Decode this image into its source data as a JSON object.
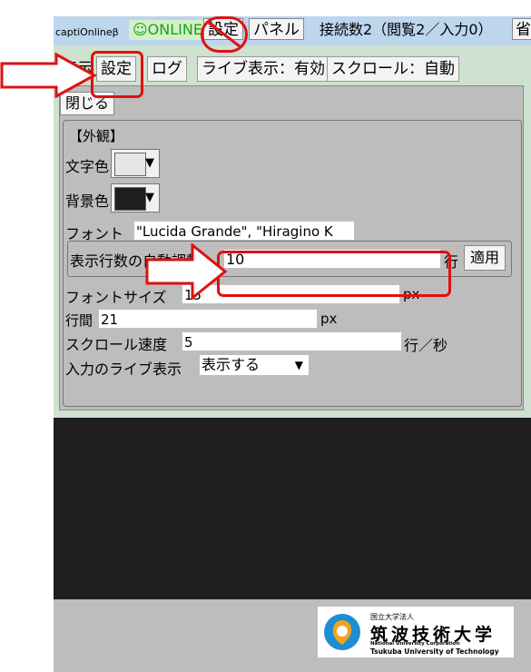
{
  "header": {
    "brand": "captiOnlineβ",
    "online": "☺ONLINE",
    "settings_label": "設定",
    "panel_label": "パネル",
    "connection_status": "接続数2（閲覧2／入力0）",
    "omit_label": "省"
  },
  "tabs": [
    {
      "label": "表示"
    },
    {
      "label": "設定"
    },
    {
      "label": "ログ"
    },
    {
      "label": "ライブ表示：有効"
    },
    {
      "label": "スクロール：自動"
    }
  ],
  "close_label": "閉じる",
  "appearance": {
    "legend": "【外観】",
    "text_color_label": "文字色",
    "text_color": "#e6e6e6",
    "bg_color_label": "背景色",
    "bg_color": "#1e1e1e",
    "font_label": "フォント",
    "font_value": "\"Lucida Grande\", \"Hiragino K",
    "auto_rows_label": "表示行数の自動調整",
    "auto_rows_value": "10",
    "rows_unit": "行",
    "apply_label": "適用",
    "font_size_label": "フォントサイズ",
    "font_size_value": "15",
    "font_size_unit": "px",
    "line_spacing_label": "行間",
    "line_spacing_value": "21",
    "line_spacing_unit": "px",
    "scroll_speed_label": "スクロール速度",
    "scroll_speed_value": "5",
    "scroll_speed_unit": "行／秒",
    "live_input_label": "入力のライブ表示",
    "live_input_value": "表示する"
  },
  "footer": {
    "logo_small": "国立大学法人",
    "logo_name": "筑波技術大学",
    "logo_en1": "National University Corporation",
    "logo_en2": "Tsukuba University of Technology"
  },
  "annotations": {
    "highlight_color": "#e01010"
  }
}
